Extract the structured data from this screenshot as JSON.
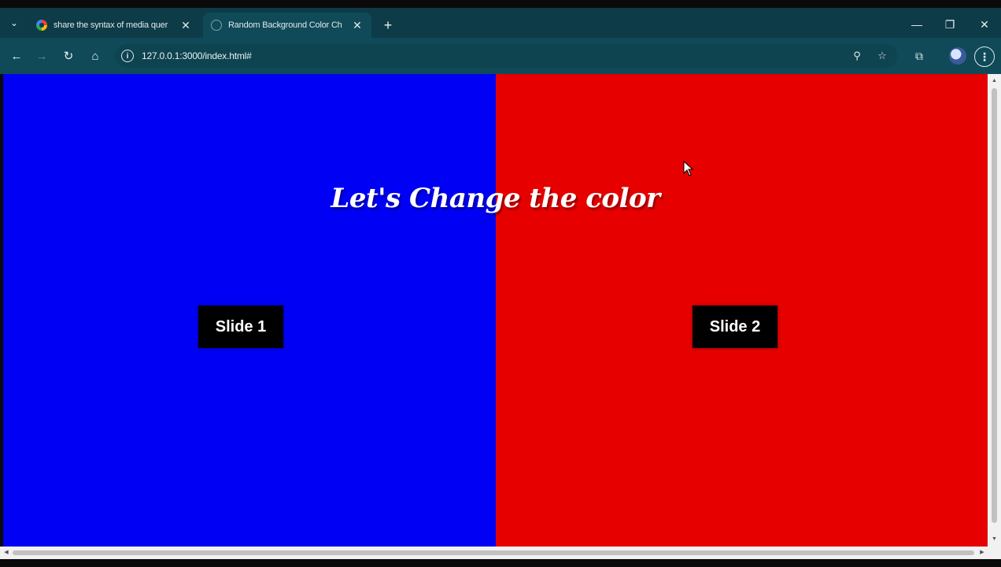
{
  "tabs": [
    {
      "title": "share the syntax of media quer",
      "close": "✕",
      "favicon": "google-favicon"
    },
    {
      "title": "Random Background Color Ch",
      "close": "✕",
      "favicon": "globe-favicon"
    }
  ],
  "tabstrip": {
    "menu_icon": "⌄",
    "new_tab": "+"
  },
  "window_controls": {
    "minimize": "—",
    "restore": "❐",
    "close": "✕"
  },
  "toolbar": {
    "back": "←",
    "forward": "→",
    "reload": "↻",
    "home": "⌂",
    "url": "127.0.0.1:3000/index.html#",
    "site_info": "i",
    "zoom_icon": "⚲",
    "bookmark_icon": "☆",
    "extensions_icon": "⧉",
    "menu": "⋮"
  },
  "page": {
    "headline": "Let's Change the color",
    "left_color": "#0000f4",
    "right_color": "#e60000",
    "slide1_label": "Slide 1",
    "slide2_label": "Slide 2"
  },
  "scrollbar": {
    "up": "▲",
    "down": "▼",
    "left": "◀",
    "right": "▶"
  }
}
